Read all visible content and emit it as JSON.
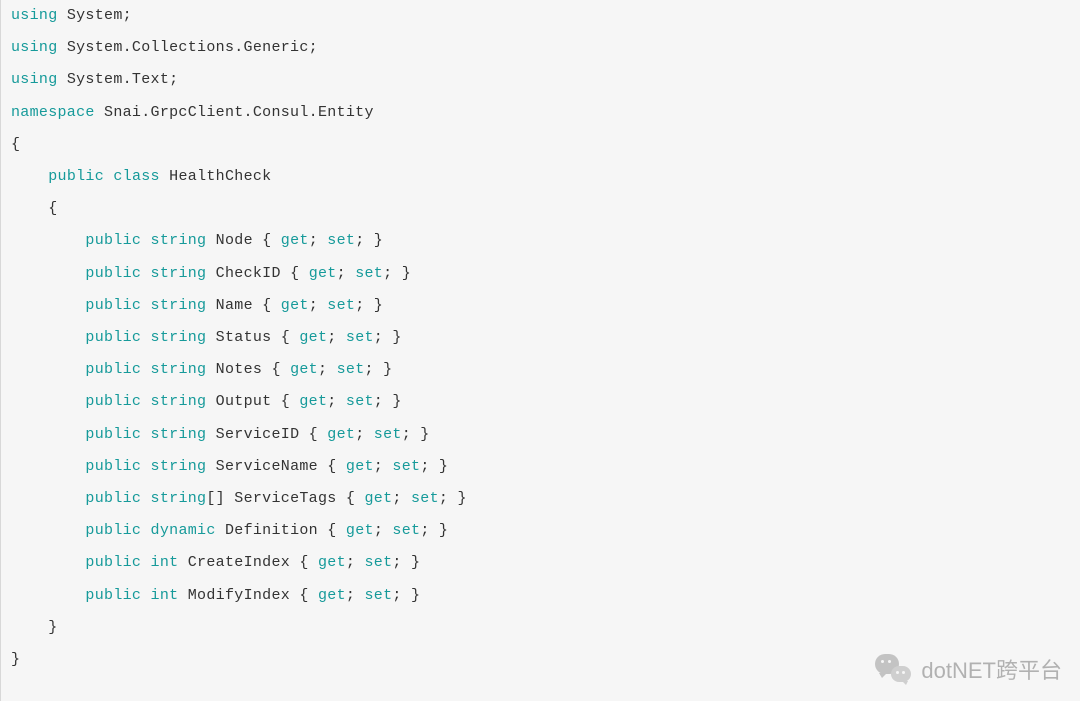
{
  "watermark": {
    "text": "dotNET跨平台"
  },
  "code": {
    "lines": [
      [
        [
          "kw",
          "using"
        ],
        [
          "plain",
          " System;"
        ]
      ],
      [
        [
          "kw",
          "using"
        ],
        [
          "plain",
          " System.Collections.Generic;"
        ]
      ],
      [
        [
          "kw",
          "using"
        ],
        [
          "plain",
          " System.Text;"
        ]
      ],
      [
        [
          "plain",
          ""
        ]
      ],
      [
        [
          "kw",
          "namespace"
        ],
        [
          "plain",
          " Snai.GrpcClient.Consul.Entity"
        ]
      ],
      [
        [
          "plain",
          "{"
        ]
      ],
      [
        [
          "plain",
          "    "
        ],
        [
          "kw",
          "public"
        ],
        [
          "plain",
          " "
        ],
        [
          "kw",
          "class"
        ],
        [
          "plain",
          " HealthCheck"
        ]
      ],
      [
        [
          "plain",
          "    {"
        ]
      ],
      [
        [
          "plain",
          "        "
        ],
        [
          "kw",
          "public"
        ],
        [
          "plain",
          " "
        ],
        [
          "kw",
          "string"
        ],
        [
          "plain",
          " Node { "
        ],
        [
          "kw",
          "get"
        ],
        [
          "plain",
          "; "
        ],
        [
          "kw",
          "set"
        ],
        [
          "plain",
          "; }"
        ]
      ],
      [
        [
          "plain",
          "        "
        ],
        [
          "kw",
          "public"
        ],
        [
          "plain",
          " "
        ],
        [
          "kw",
          "string"
        ],
        [
          "plain",
          " CheckID { "
        ],
        [
          "kw",
          "get"
        ],
        [
          "plain",
          "; "
        ],
        [
          "kw",
          "set"
        ],
        [
          "plain",
          "; }"
        ]
      ],
      [
        [
          "plain",
          "        "
        ],
        [
          "kw",
          "public"
        ],
        [
          "plain",
          " "
        ],
        [
          "kw",
          "string"
        ],
        [
          "plain",
          " Name { "
        ],
        [
          "kw",
          "get"
        ],
        [
          "plain",
          "; "
        ],
        [
          "kw",
          "set"
        ],
        [
          "plain",
          "; }"
        ]
      ],
      [
        [
          "plain",
          "        "
        ],
        [
          "kw",
          "public"
        ],
        [
          "plain",
          " "
        ],
        [
          "kw",
          "string"
        ],
        [
          "plain",
          " Status { "
        ],
        [
          "kw",
          "get"
        ],
        [
          "plain",
          "; "
        ],
        [
          "kw",
          "set"
        ],
        [
          "plain",
          "; }"
        ]
      ],
      [
        [
          "plain",
          "        "
        ],
        [
          "kw",
          "public"
        ],
        [
          "plain",
          " "
        ],
        [
          "kw",
          "string"
        ],
        [
          "plain",
          " Notes { "
        ],
        [
          "kw",
          "get"
        ],
        [
          "plain",
          "; "
        ],
        [
          "kw",
          "set"
        ],
        [
          "plain",
          "; }"
        ]
      ],
      [
        [
          "plain",
          "        "
        ],
        [
          "kw",
          "public"
        ],
        [
          "plain",
          " "
        ],
        [
          "kw",
          "string"
        ],
        [
          "plain",
          " Output { "
        ],
        [
          "kw",
          "get"
        ],
        [
          "plain",
          "; "
        ],
        [
          "kw",
          "set"
        ],
        [
          "plain",
          "; }"
        ]
      ],
      [
        [
          "plain",
          "        "
        ],
        [
          "kw",
          "public"
        ],
        [
          "plain",
          " "
        ],
        [
          "kw",
          "string"
        ],
        [
          "plain",
          " ServiceID { "
        ],
        [
          "kw",
          "get"
        ],
        [
          "plain",
          "; "
        ],
        [
          "kw",
          "set"
        ],
        [
          "plain",
          "; }"
        ]
      ],
      [
        [
          "plain",
          "        "
        ],
        [
          "kw",
          "public"
        ],
        [
          "plain",
          " "
        ],
        [
          "kw",
          "string"
        ],
        [
          "plain",
          " ServiceName { "
        ],
        [
          "kw",
          "get"
        ],
        [
          "plain",
          "; "
        ],
        [
          "kw",
          "set"
        ],
        [
          "plain",
          "; }"
        ]
      ],
      [
        [
          "plain",
          "        "
        ],
        [
          "kw",
          "public"
        ],
        [
          "plain",
          " "
        ],
        [
          "kw",
          "string"
        ],
        [
          "plain",
          "[] ServiceTags { "
        ],
        [
          "kw",
          "get"
        ],
        [
          "plain",
          "; "
        ],
        [
          "kw",
          "set"
        ],
        [
          "plain",
          "; }"
        ]
      ],
      [
        [
          "plain",
          "        "
        ],
        [
          "kw",
          "public"
        ],
        [
          "plain",
          " "
        ],
        [
          "kw",
          "dynamic"
        ],
        [
          "plain",
          " Definition { "
        ],
        [
          "kw",
          "get"
        ],
        [
          "plain",
          "; "
        ],
        [
          "kw",
          "set"
        ],
        [
          "plain",
          "; }"
        ]
      ],
      [
        [
          "plain",
          "        "
        ],
        [
          "kw",
          "public"
        ],
        [
          "plain",
          " "
        ],
        [
          "kw",
          "int"
        ],
        [
          "plain",
          " CreateIndex { "
        ],
        [
          "kw",
          "get"
        ],
        [
          "plain",
          "; "
        ],
        [
          "kw",
          "set"
        ],
        [
          "plain",
          "; }"
        ]
      ],
      [
        [
          "plain",
          "        "
        ],
        [
          "kw",
          "public"
        ],
        [
          "plain",
          " "
        ],
        [
          "kw",
          "int"
        ],
        [
          "plain",
          " ModifyIndex { "
        ],
        [
          "kw",
          "get"
        ],
        [
          "plain",
          "; "
        ],
        [
          "kw",
          "set"
        ],
        [
          "plain",
          "; }"
        ]
      ],
      [
        [
          "plain",
          "    }"
        ]
      ],
      [
        [
          "plain",
          "}"
        ]
      ]
    ]
  }
}
